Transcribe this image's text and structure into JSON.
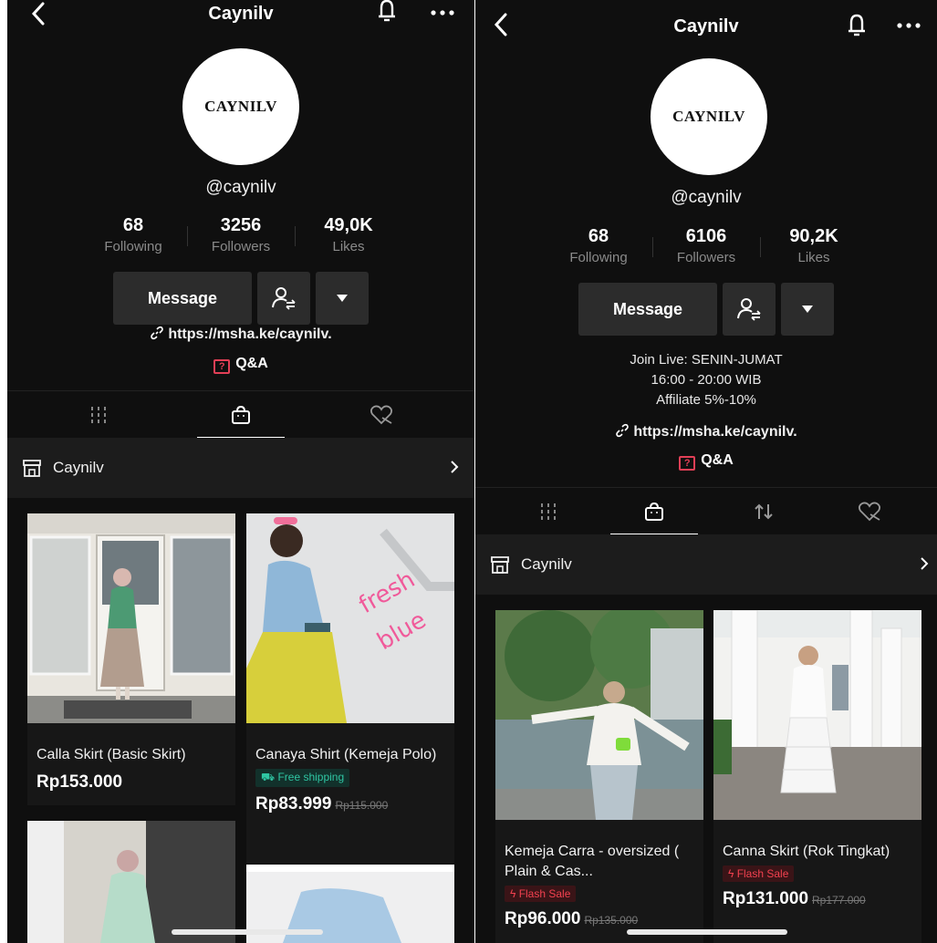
{
  "left": {
    "title": "Caynilv",
    "avatar_text": "CAYNILV",
    "handle": "@caynilv",
    "stats": [
      {
        "value": "68",
        "label": "Following"
      },
      {
        "value": "3256",
        "label": "Followers"
      },
      {
        "value": "49,0K",
        "label": "Likes"
      }
    ],
    "message_label": "Message",
    "link": "https://msha.ke/caynilv.",
    "qa_label": "Q&A",
    "shop_name": "Caynilv",
    "products": [
      {
        "name": "Calla  Skirt (Basic Skirt)",
        "price": "Rp153.000",
        "old_price": "",
        "tag": ""
      },
      {
        "name": "Canaya Shirt (Kemeja Polo)",
        "price": "Rp83.999",
        "old_price": "Rp115.000",
        "tag": "Free shipping"
      }
    ]
  },
  "right": {
    "title": "Caynilv",
    "avatar_text": "CAYNILV",
    "handle": "@caynilv",
    "stats": [
      {
        "value": "68",
        "label": "Following"
      },
      {
        "value": "6106",
        "label": "Followers"
      },
      {
        "value": "90,2K",
        "label": "Likes"
      }
    ],
    "message_label": "Message",
    "bio": [
      "Join Live: SENIN-JUMAT",
      "16:00 - 20:00 WIB",
      "Affiliate 5%-10%"
    ],
    "link": "https://msha.ke/caynilv.",
    "qa_label": "Q&A",
    "shop_name": "Caynilv",
    "products": [
      {
        "name": "Kemeja Carra - oversized ( Plain & Cas...",
        "price": "Rp96.000",
        "old_price": "Rp135.000",
        "tag": "Flash Sale"
      },
      {
        "name": "Canna Skirt (Rok Tingkat)",
        "price": "Rp131.000",
        "old_price": "Rp177.000",
        "tag": "Flash Sale"
      }
    ]
  },
  "colors": {
    "background": "#0f0f0f",
    "button": "#2c2c2c",
    "qa_red": "#e23f56",
    "free_shipping": "#2fc6a3",
    "flash_sale": "#f2414f"
  }
}
